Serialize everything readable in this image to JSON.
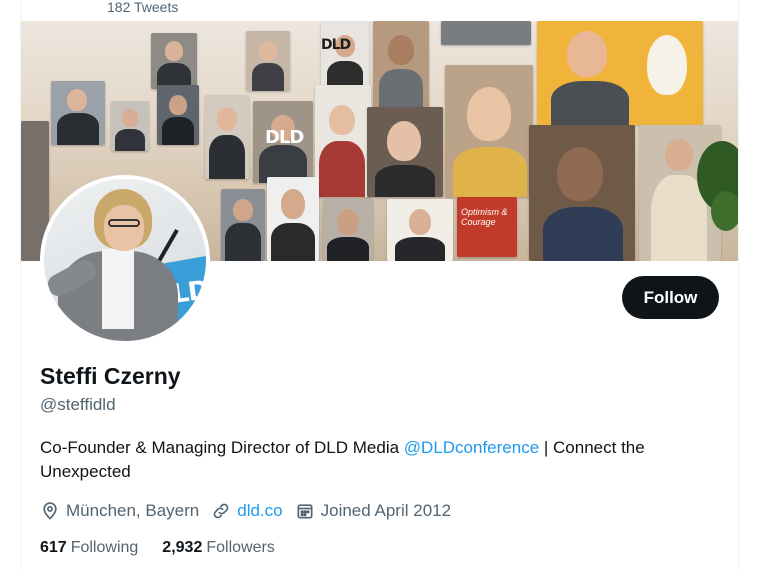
{
  "header": {
    "tweet_count": "182 Tweets"
  },
  "banner": {
    "logo_text": "DLD",
    "poster_text": "Optimism & Courage"
  },
  "avatar": {
    "podium_logo": "DLD"
  },
  "profile": {
    "follow_label": "Follow",
    "display_name": "Steffi Czerny",
    "handle": "@steffidld",
    "bio_prefix": "Co-Founder & Managing Director of DLD Media ",
    "bio_mention": "@DLDconference",
    "bio_suffix": " | Connect the Unexpected",
    "location": "München, Bayern",
    "website": "dld.co",
    "joined": "Joined April 2012",
    "following_count": "617",
    "following_label": "Following",
    "followers_count": "2,932",
    "followers_label": "Followers"
  },
  "icons": {
    "location": "location-pin-icon",
    "website": "link-icon",
    "joined": "calendar-icon"
  },
  "colors": {
    "accent": "#1d9bf0",
    "text_primary": "#0f1419",
    "text_secondary": "#536471",
    "button_bg": "#0f1419"
  }
}
